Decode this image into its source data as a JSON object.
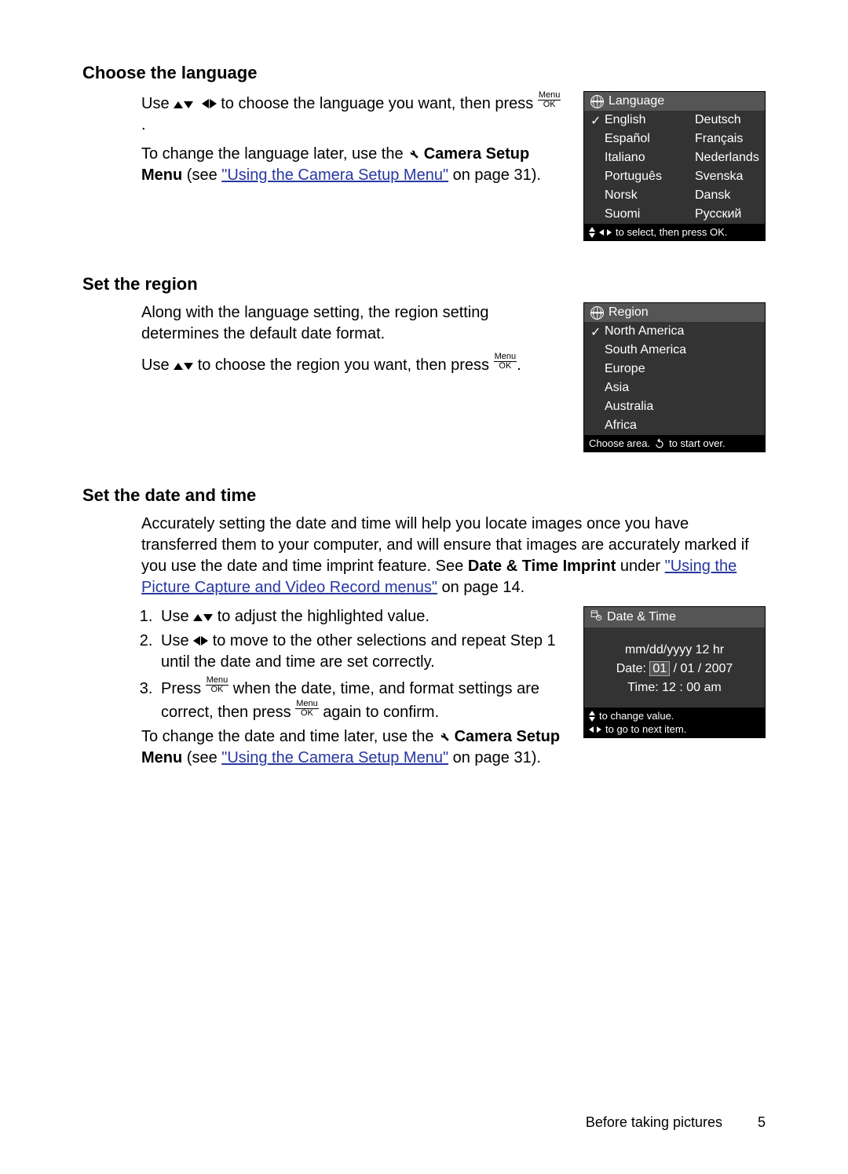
{
  "section1": {
    "heading": "Choose the language",
    "p1_a": "Use ",
    "p1_b": " to choose the language you want, then press ",
    "p1_c": ".",
    "p2_a": "To change the language later, use the ",
    "p2_b": " Camera Setup Menu",
    "p2_c": " (see ",
    "link": "\"Using the Camera Setup Menu\"",
    "p2_d": " on page 31).",
    "panel": {
      "title": "Language",
      "langs": [
        "English",
        "Deutsch",
        "Español",
        "Français",
        "Italiano",
        "Nederlands",
        "Português",
        "Svenska",
        "Norsk",
        "Dansk",
        "Suomi",
        "Русский"
      ],
      "foot": " to select, then press OK."
    }
  },
  "section2": {
    "heading": "Set the region",
    "p1": "Along with the language setting, the region setting determines the default date format.",
    "p2_a": "Use ",
    "p2_b": " to choose the region you want, then press ",
    "p2_c": ".",
    "panel": {
      "title": "Region",
      "items": [
        "North America",
        "South America",
        "Europe",
        "Asia",
        "Australia",
        "Africa"
      ],
      "foot_a": "Choose area. ",
      "foot_b": " to start over."
    }
  },
  "section3": {
    "heading": "Set the date and time",
    "intro_a": "Accurately setting the date and time will help you locate images once you have transferred them to your computer, and will ensure that images are accurately marked if you use the date and time imprint feature. See ",
    "intro_bold": "Date & Time Imprint",
    "intro_b": " under ",
    "link": "\"Using the Picture Capture and Video Record menus\"",
    "intro_c": " on page 14.",
    "li1_a": "Use ",
    "li1_b": " to adjust the highlighted value.",
    "li2_a": "Use ",
    "li2_b": " to move to the other selections and repeat Step 1 until the date and time are set correctly.",
    "li3_a": "Press ",
    "li3_b": " when the date, time, and format settings are correct, then press ",
    "li3_c": " again to confirm.",
    "outro_a": "To change the date and time later, use the ",
    "outro_b": " Camera Setup Menu",
    "outro_c": " (see ",
    "link2": "\"Using the Camera Setup Menu\"",
    "outro_d": " on page 31).",
    "panel": {
      "title": "Date & Time",
      "fmt": "mm/dd/yyyy  12 hr",
      "date_label": "Date:  ",
      "date_hl": "01",
      "date_rest": " / 01 / 2007",
      "time": "Time:  12 : 00  am",
      "foot1": " to change value.",
      "foot2": " to go to next item."
    }
  },
  "footer": {
    "chapter": "Before taking pictures",
    "page": "5"
  }
}
